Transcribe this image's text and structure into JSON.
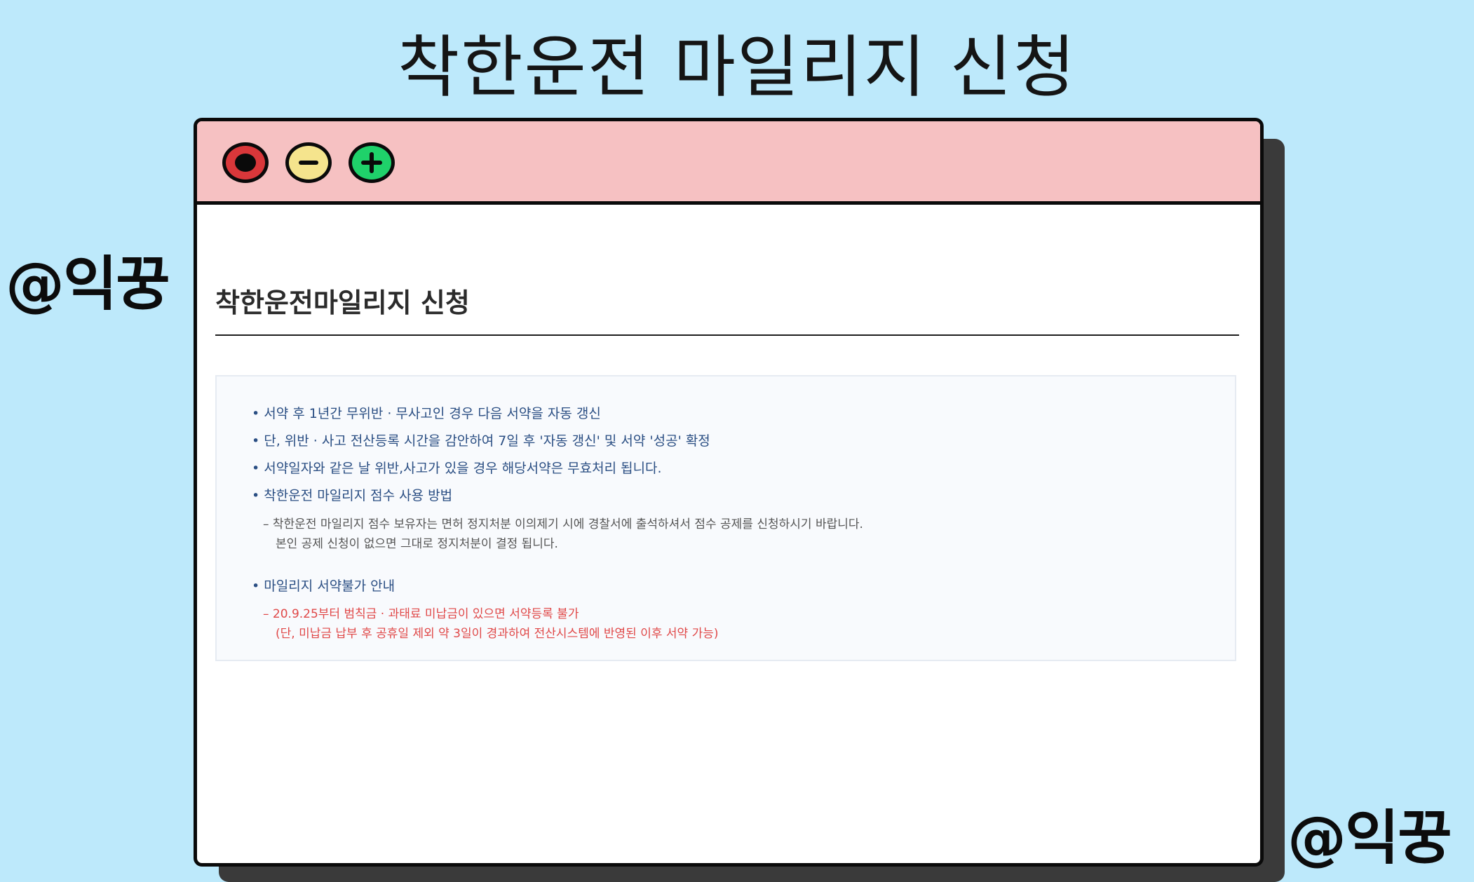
{
  "heading": "착한운전 마일리지 신청",
  "watermarks": {
    "left": "@익꿍",
    "right": "@익꿍"
  },
  "window": {
    "buttons": {
      "close": "close",
      "minimize": "minimize",
      "maximize": "maximize"
    }
  },
  "page": {
    "title": "착한운전마일리지 신청",
    "notice": {
      "bullet1": "서약 후 1년간 무위반 · 무사고인 경우 다음 서약을 자동 갱신",
      "bullet2": "단, 위반 · 사고 전산등록 시간을 감안하여 7일 후 '자동 갱신' 및 서약 '성공' 확정",
      "bullet3": "서약일자와 같은 날 위반,사고가 있을 경우 해당서약은 무효처리 됩니다.",
      "bullet4": "착한운전 마일리지 점수 사용 방법",
      "bullet4_sub1": "착한운전 마일리지 점수 보유자는 면허 정지처분 이의제기 시에 경찰서에 출석하셔서 점수 공제를 신청하시기 바랍니다.",
      "bullet4_sub2": "본인 공제 신청이 없으면 그대로 정지처분이 결정 됩니다.",
      "bullet5": "마일리지 서약불가 안내",
      "bullet5_sub1": "20.9.25부터 범칙금 · 과태료 미납금이 있으면 서약등록 불가",
      "bullet5_sub2": "(단, 미납금 납부 후 공휴일 제외 약 3일이 경과하여 전산시스템에 반영된 이후 서약 가능)"
    }
  },
  "colors": {
    "background": "#bde9fb",
    "titlebar": "#f6c1c2",
    "close": "#d9373a",
    "minimize": "#f5e48d",
    "maximize": "#1fd16a",
    "notice_blue": "#2a4e83",
    "notice_red": "#e04848"
  }
}
